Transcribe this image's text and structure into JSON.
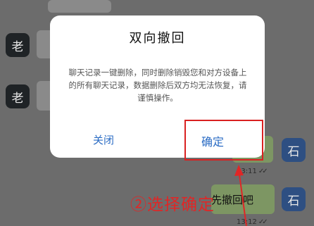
{
  "chat": {
    "avatar_left_1": "老",
    "avatar_left_2": "老",
    "avatar_right_1": "石",
    "avatar_right_2": "石",
    "message_out": "先撤回吧",
    "time_1": "13:11",
    "time_2": "13:12"
  },
  "dialog": {
    "title": "双向撤回",
    "message": "聊天记录一键删除，同时删除销毁您和对方设备上的所有聊天记录，数据删除后双方均无法恢复，请谨慎操作。",
    "close_label": "关闭",
    "confirm_label": "确定"
  },
  "annotation": {
    "text": "②选择确定",
    "color": "#e02626"
  },
  "colors": {
    "dialog_button": "#2b6cc4",
    "highlight": "#d92121"
  }
}
